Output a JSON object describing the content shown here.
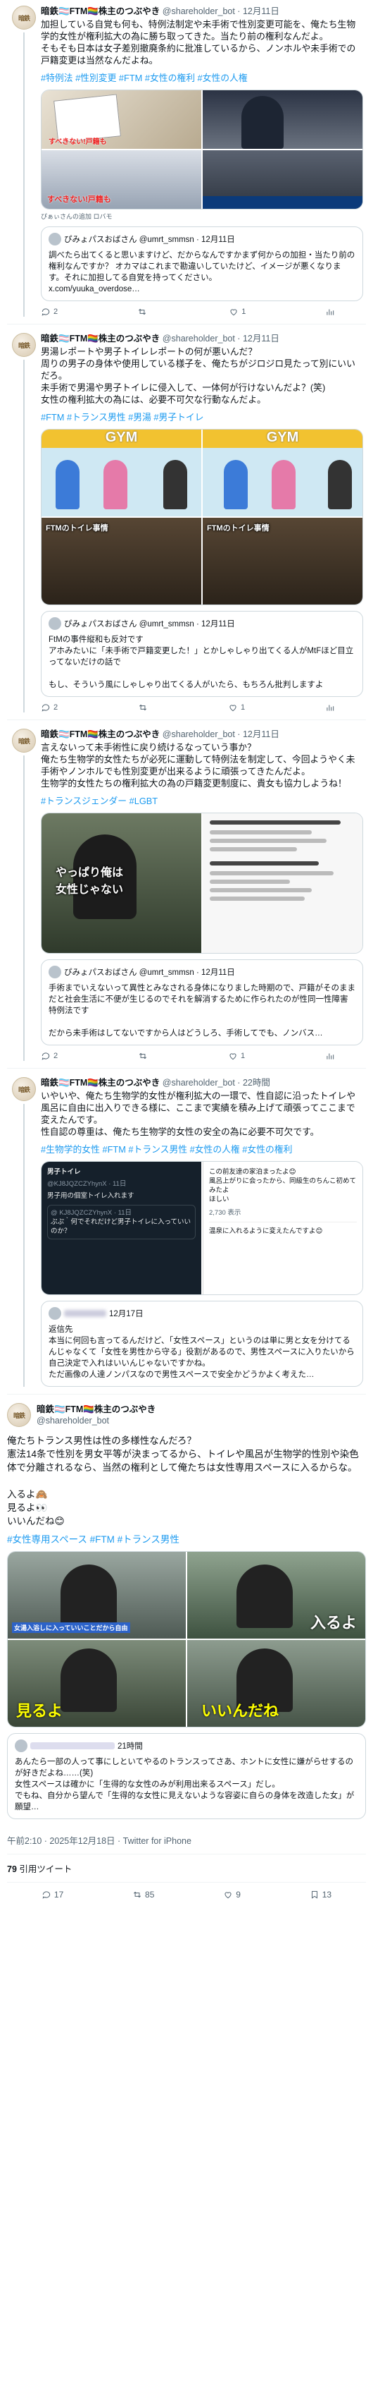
{
  "tweets": [
    {
      "name": "暗鉄🏳️‍⚧️FTM🏳️‍🌈株主のつぶやき",
      "handle": "@shareholder_bot · 12月11日",
      "text": "加担している自覚も何も、特例法制定や未手術で性別変更可能を、俺たち生物学的女性が権利拡大の為に勝ち取ってきた。当たり前の権利なんだよ。\nそもそも日本は女子差別撤廃条約に批准しているから、ノンホルや未手術での戸籍変更は当然なんだよね。",
      "tags": "#特例法 #性別変更 #FTM #女性の権利 #女性の人権",
      "credit": "ぴぁぃさんの追加 ロバモ",
      "quote": {
        "author": "ぴみょパスおばさん @umrt_smmsn · 12月11日",
        "text": "調べたら出てくると思いますけど、だからなんですかまず何からの加担・当たり前の権利なんですか？ オカマはこれまで勘違いしていたけど、イメージが悪くなります。それに加担してる自覚を持ってください。\nx.com/yuuka_overdose…"
      },
      "counts": {
        "reply": "2",
        "retweet": "",
        "like": "1",
        "views": ""
      }
    },
    {
      "name": "暗鉄🏳️‍⚧️FTM🏳️‍🌈株主のつぶやき",
      "handle": "@shareholder_bot · 12月11日",
      "text": "男湯レポートや男子トイレレポートの何が悪いんだ？\n周りの男子の身体や使用している様子を、俺たちがジロジロ見たって別にいいだろ。\n未手術で男湯や男子トイレに侵入して、一体何が行けないんだよ？(笑)\n女性の権利拡大の為には、必要不可欠な行動なんだよ。",
      "tags": "#FTM #トランス男性 #男湯 #男子トイレ",
      "panel_top_left": "GYM",
      "panel_top_right": "GYM",
      "panel_caption_1": "FTMのトイレ事情",
      "panel_caption_2": "FTMのトイレ事情",
      "quote": {
        "author": "ぴみょパスおばさん @umrt_smmsn · 12月11日",
        "text": "FtMの事件縦和も反対です\nアホみたいに「未手術で戸籍変更した！」とかしゃしゃり出てくる人がMtFほど目立ってないだけの話で\n\nもし、そういう風にしゃしゃり出てくる人がいたら、もちろん批判しますよ"
      },
      "counts": {
        "reply": "2",
        "retweet": "",
        "like": "1",
        "views": ""
      }
    },
    {
      "name": "暗鉄🏳️‍⚧️FTM🏳️‍🌈株主のつぶやき",
      "handle": "@shareholder_bot · 12月11日",
      "text": "言えないって未手術性に戻り続けるなっていう事か？\n俺たち生物学的女性たちが必死に運動して特例法を制定して、今回ようやく未手術やノンホルでも性別変更が出来るように頑張ってきたんだよ。\n生物学的女性たちの権利拡大の為の戸籍変更制度に、貴女も協力しようね！",
      "tags": "#トランスジェンダー #LGBT",
      "img_left_caption": "やっぱり俺は\n女性じゃない",
      "quote": {
        "author": "ぴみょパスおばさん @umrt_smmsn · 12月11日",
        "text": "手術までいえないって異性とみなされる身体になりました時期ので、戸籍がそのままだと社会生活に不便が生じるのでそれを解消するために作られたのが性同一性障害特例法です\n\nだから未手術はしてないですから人はどうしろ、手術してでも、ノンバス…"
      },
      "counts": {
        "reply": "2",
        "retweet": "",
        "like": "1",
        "views": ""
      }
    },
    {
      "name": "暗鉄🏳️‍⚧️FTM🏳️‍🌈株主のつぶやき",
      "handle": "@shareholder_bot · 22時間",
      "text": "いやいや、俺たち生物学的女性が権利拡大の一環で、性自認に沿ったトイレや風呂に自由に出入りできる様に、ここまで実績を積み上げて頑張ってここまで変えたんです。\n性自認の尊重は、俺たち生物学的女性の安全の為に必要不可欠です。",
      "tags": "#生物学的女性 #FTM #トランス男性 #女性の人権 #女性の権利",
      "screenshot_left_title": "男子トイレ",
      "screenshot_left_name": "@KJ8JQZCZYhynX · 11日",
      "screenshot_left_text": "男子用の個室トイレ入れます",
      "screenshot_left_quote": "@ KJ8JQZCZYhynX · 11日",
      "screenshot_left_qtext": "ぷぷ｀何でそれだけど男子トイレに入っていいのか？",
      "screenshot_right_text": "この前友達の家泊まったよ😊\n風呂上がりに会ったから、同級生のちんこ初めてみたよ\nほしい",
      "screenshot_right_stats": "2,730 表示",
      "screenshot_right_reply": "温泉に入れるように変えたんですよ😊",
      "quote_author": "12月17日",
      "quote_text": "返信先\n本当に何回も言ってるんだけど、「女性スペース」というのは単に男と女を分けてるんじゃなくて「女性を男性から守る」役割があるので、男性スペースに入りたいから自己決定で入れはいいんじゃないですかね。\nただ画像の人達ノンパスなので男性スペースで安全かどうかよく考えた…",
      "counts": {
        "reply": "",
        "retweet": "",
        "like": "",
        "views": ""
      }
    },
    {
      "name": "暗鉄🏳️‍⚧️FTM🏳️‍🌈株主のつぶやき",
      "handle": "@shareholder_bot",
      "text": "俺たちトランス男性は性の多様性なんだろ？\n憲法14条で性別を男女平等が決まってるから、トイレや風呂が生物学的性別や染色体で分離されるなら、当然の権利として俺たちは女性専用スペースに入るからな。\n\n入るよ🙈\n見るよ👀\nいいんだね😊",
      "tags": "#女性専用スペース #FTM #トランス男性",
      "panel_captions": [
        "女湯入浴しに入っていいことだから自由",
        "入るよ",
        "見るよ",
        "いいんだね"
      ],
      "quote": {
        "author": "21時間",
        "text": "あんたら一部の人って事にしといてやるのトランスってさあ、ホントに女性に嫌がらせするのが好きだよね……(笑)\n女性スペースは確かに「生得的な女性のみが利用出来るスペース」だし。\nでもね、自分から望んで「生得的な女性に見えないような容姿に自らの身体を改造した女」が願望…"
      },
      "counts": {
        "reply": "",
        "retweet": "",
        "like": "",
        "views": ""
      }
    }
  ],
  "meta": {
    "timestamp": "午前2:10 · 2025年12月18日 · Twitter for iPhone",
    "quote_count": "79",
    "quote_label": "引用ツイート"
  },
  "bottom": {
    "reply": "17",
    "retweet": "85",
    "like": "9",
    "bookmark": "13"
  },
  "colors": {
    "link": "#1d9bf0",
    "muted": "#536471",
    "border": "#cfd9de"
  },
  "icons": [
    "reply-icon",
    "retweet-icon",
    "like-icon",
    "views-icon",
    "bookmark-icon"
  ]
}
